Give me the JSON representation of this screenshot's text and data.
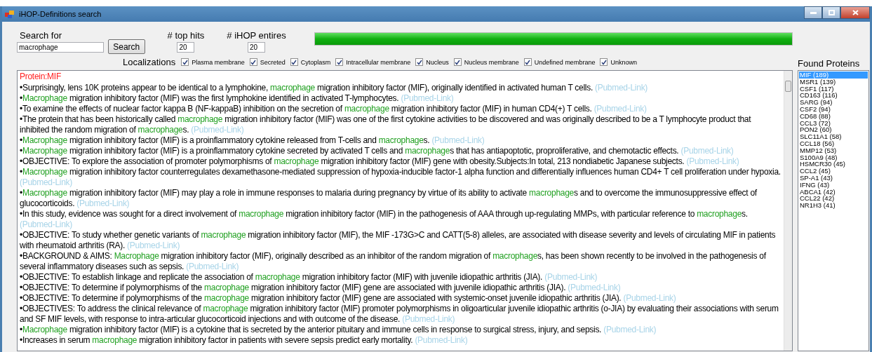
{
  "window": {
    "title": "iHOP-Definitions search"
  },
  "search": {
    "label": "Search for",
    "value": "macrophage",
    "button": "Search"
  },
  "top_hits": {
    "label": "# top hits",
    "value": "20"
  },
  "ihop_entries": {
    "label": "# iHOP entires",
    "value": "20"
  },
  "progress": {
    "level": 1
  },
  "localizations": {
    "label": "Localizations",
    "options": [
      {
        "label": "Plasma membrane",
        "checked": true
      },
      {
        "label": "Secreted",
        "checked": true
      },
      {
        "label": "Cytoplasm",
        "checked": true
      },
      {
        "label": "Intracellular membrane",
        "checked": true
      },
      {
        "label": "Nucleus",
        "checked": true
      },
      {
        "label": "Nucleus membrane",
        "checked": true
      },
      {
        "label": "Undefined membrane",
        "checked": true
      },
      {
        "label": "Unknown",
        "checked": true
      }
    ]
  },
  "results": {
    "heading": "Protein:MIF",
    "entries": [
      {
        "parts": [
          {
            "text": "•Surprisingly, lens 10K proteins appear to be identical to a lymphokine, ",
            "highlight": false
          },
          {
            "text": "macrophage",
            "highlight": true
          },
          {
            "text": " migration inhibitory factor (MIF), originally identified in activated human T cells. ",
            "highlight": false
          }
        ],
        "link": "(Pubmed-Link)"
      },
      {
        "parts": [
          {
            "text": "•",
            "highlight": false
          },
          {
            "text": "Macrophage",
            "highlight": true
          },
          {
            "text": " migration inhibitory factor (MIF) was the first lymphokine identified in activated T-lymphocytes. ",
            "highlight": false
          }
        ],
        "link": "(Pubmed-Link)"
      },
      {
        "parts": [
          {
            "text": "•To examine the effects of nuclear factor kappa B (NF-kappaB) inhibition on the secretion of ",
            "highlight": false
          },
          {
            "text": "macrophage",
            "highlight": true
          },
          {
            "text": " migration inhibitory factor (MIF) in human CD4(+) T cells. ",
            "highlight": false
          }
        ],
        "link": "(Pubmed-Link)"
      },
      {
        "parts": [
          {
            "text": "•The protein that has been historically called ",
            "highlight": false
          },
          {
            "text": "macrophage",
            "highlight": true
          },
          {
            "text": " migration inhibitory factor (MIF) was one of the first cytokine activities to be discovered and was originally described to be a T lymphocyte product that inhibited the random migration of ",
            "highlight": false
          },
          {
            "text": "macrophage",
            "highlight": true
          },
          {
            "text": "s. ",
            "highlight": false
          }
        ],
        "link": "(Pubmed-Link)"
      },
      {
        "parts": [
          {
            "text": "•",
            "highlight": false
          },
          {
            "text": "Macrophage",
            "highlight": true
          },
          {
            "text": " migration inhibitory factor (MIF) is a proinflammatory cytokine released from T-cells and ",
            "highlight": false
          },
          {
            "text": "macrophage",
            "highlight": true
          },
          {
            "text": "s. ",
            "highlight": false
          }
        ],
        "link": "(Pubmed-Link)"
      },
      {
        "parts": [
          {
            "text": "•",
            "highlight": false
          },
          {
            "text": "Macrophage",
            "highlight": true
          },
          {
            "text": " migration inhibitory factor (MIF) is a proinflammatory cytokine secreted by activated T cells and ",
            "highlight": false
          },
          {
            "text": "macrophage",
            "highlight": true
          },
          {
            "text": "s that has antiapoptotic, proproliferative, and chemotactic effects. ",
            "highlight": false
          }
        ],
        "link": "(Pubmed-Link)"
      },
      {
        "parts": [
          {
            "text": "•OBJECTIVE: To explore the association of promoter polymorphisms of ",
            "highlight": false
          },
          {
            "text": "macrophage",
            "highlight": true
          },
          {
            "text": " migration inhibitory factor (MIF) gene with obesity.Subjects:In total, 213 nondiabetic Japanese subjects. ",
            "highlight": false
          }
        ],
        "link": "(Pubmed-Link)"
      },
      {
        "parts": [
          {
            "text": "•",
            "highlight": false
          },
          {
            "text": "Macrophage",
            "highlight": true
          },
          {
            "text": " migration inhibitory factor counterregulates dexamethasone-mediated suppression of hypoxia-inducible factor-1 alpha function and differentially influences human CD4+ T cell proliferation under hypoxia. ",
            "highlight": false
          }
        ],
        "link": "(Pubmed-Link)"
      },
      {
        "parts": [
          {
            "text": "•",
            "highlight": false
          },
          {
            "text": "Macrophage",
            "highlight": true
          },
          {
            "text": " migration inhibitory factor (MIF) may play a role in immune responses to malaria during pregnancy by virtue of its ability to activate ",
            "highlight": false
          },
          {
            "text": "macrophage",
            "highlight": true
          },
          {
            "text": "s and to overcome the immunosuppressive effect of glucocorticoids. ",
            "highlight": false
          }
        ],
        "link": "(Pubmed-Link)"
      },
      {
        "parts": [
          {
            "text": "•In this study, evidence was sought for a direct involvement of ",
            "highlight": false
          },
          {
            "text": "macrophage",
            "highlight": true
          },
          {
            "text": " migration inhibitory factor (MIF) in the pathogenesis of AAA through up-regulating MMPs, with particular reference to ",
            "highlight": false
          },
          {
            "text": "macrophage",
            "highlight": true
          },
          {
            "text": "s. ",
            "highlight": false
          }
        ],
        "link": "(Pubmed-Link)"
      },
      {
        "parts": [
          {
            "text": "•OBJECTIVE: To study whether genetic variants of ",
            "highlight": false
          },
          {
            "text": "macrophage",
            "highlight": true
          },
          {
            "text": " migration inhibitory factor (MIF), the MIF -173G>C and CATT(5-8) alleles, are associated with disease severity and levels of circulating MIF in patients with rheumatoid arthritis (RA). ",
            "highlight": false
          }
        ],
        "link": "(Pubmed-Link)"
      },
      {
        "parts": [
          {
            "text": "•BACKGROUND & AIMS: ",
            "highlight": false
          },
          {
            "text": "Macrophage",
            "highlight": true
          },
          {
            "text": " migration inhibitory factor (MIF), originally described as an inhibitor of the random migration of ",
            "highlight": false
          },
          {
            "text": "macrophage",
            "highlight": true
          },
          {
            "text": "s, has been shown recently to be involved in the pathogenesis of several inflammatory diseases such as sepsis. ",
            "highlight": false
          }
        ],
        "link": "(Pubmed-Link)"
      },
      {
        "parts": [
          {
            "text": "•OBJECTIVE: To establish linkage and replicate the association of ",
            "highlight": false
          },
          {
            "text": "macrophage",
            "highlight": true
          },
          {
            "text": " migration inhibitory factor (MIF) with juvenile idiopathic arthritis (JIA). ",
            "highlight": false
          }
        ],
        "link": "(Pubmed-Link)"
      },
      {
        "parts": [
          {
            "text": "•OBJECTIVE: To determine if polymorphisms of the ",
            "highlight": false
          },
          {
            "text": "macrophage",
            "highlight": true
          },
          {
            "text": " migration inhibitory factor (MIF) gene are associated with juvenile idiopathic arthritis (JIA). ",
            "highlight": false
          }
        ],
        "link": "(Pubmed-Link)"
      },
      {
        "parts": [
          {
            "text": "•OBJECTIVE: To determine if polymorphisms of the ",
            "highlight": false
          },
          {
            "text": "macrophage",
            "highlight": true
          },
          {
            "text": " migration inhibitory factor (MIF) gene are associated with systemic-onset juvenile idiopathic arthritis (JIA). ",
            "highlight": false
          }
        ],
        "link": "(Pubmed-Link)"
      },
      {
        "parts": [
          {
            "text": "•OBJECTIVES: To address the clinical relevance of ",
            "highlight": false
          },
          {
            "text": "macrophage",
            "highlight": true
          },
          {
            "text": " migration inhibitory factor (MIF) promoter polymorphisms in oligoarticular juvenile idiopathic arthritis (o-JIA) by evaluating their associations with serum and SF MIF levels, with response to intra-articular glucocorticoid injections and with outcome of the disease. ",
            "highlight": false
          }
        ],
        "link": "(Pubmed-Link)"
      },
      {
        "parts": [
          {
            "text": "•",
            "highlight": false
          },
          {
            "text": "Macrophage",
            "highlight": true
          },
          {
            "text": " migration inhibitory factor (MIF) is a cytokine that is secreted by the anterior pituitary and immune cells in response to surgical stress, injury, and sepsis. ",
            "highlight": false
          }
        ],
        "link": "(Pubmed-Link)"
      },
      {
        "parts": [
          {
            "text": "•Increases in serum ",
            "highlight": false
          },
          {
            "text": "macrophage",
            "highlight": true
          },
          {
            "text": " migration inhibitory factor in patients with severe sepsis predict early mortality. ",
            "highlight": false
          }
        ],
        "link": "(Pubmed-Link)"
      }
    ]
  },
  "found_proteins": {
    "label": "Found Proteins",
    "items": [
      {
        "label": "MIF (189)",
        "selected": true
      },
      {
        "label": "MSR1 (139)",
        "selected": false
      },
      {
        "label": "CSF1 (117)",
        "selected": false
      },
      {
        "label": "CD163 (116)",
        "selected": false
      },
      {
        "label": "SARG (94)",
        "selected": false
      },
      {
        "label": "CSF2 (94)",
        "selected": false
      },
      {
        "label": "CD68 (88)",
        "selected": false
      },
      {
        "label": "CCL3 (72)",
        "selected": false
      },
      {
        "label": "PON2 (60)",
        "selected": false
      },
      {
        "label": "SLC11A1 (58)",
        "selected": false
      },
      {
        "label": "CCL18 (56)",
        "selected": false
      },
      {
        "label": "MMP12 (53)",
        "selected": false
      },
      {
        "label": "S100A9 (48)",
        "selected": false
      },
      {
        "label": "HSMCR30 (45)",
        "selected": false
      },
      {
        "label": "CCL2 (45)",
        "selected": false
      },
      {
        "label": "SP-A1 (43)",
        "selected": false
      },
      {
        "label": "IFNG (43)",
        "selected": false
      },
      {
        "label": "ABCA1 (42)",
        "selected": false
      },
      {
        "label": "CCL22 (42)",
        "selected": false
      },
      {
        "label": "NR1H3 (41)",
        "selected": false
      }
    ]
  }
}
